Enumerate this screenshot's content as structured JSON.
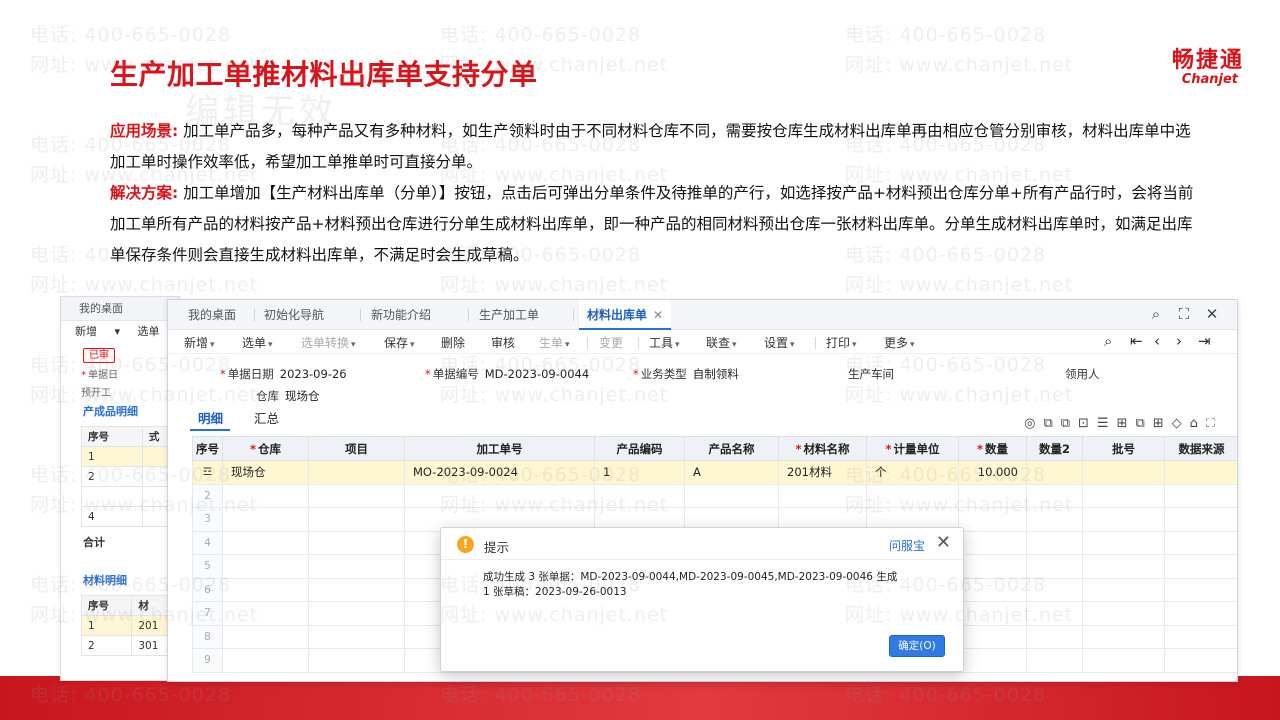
{
  "slide": {
    "title": "生产加工单推材料出库单支持分单",
    "ghost_text": "编辑无效",
    "logo_cn": "畅捷通",
    "logo_en": "Chanjet",
    "scene_label": "应用场景:",
    "scene_text": "加工单产品多，每种产品又有多种材料，如生产领料时由于不同材料仓库不同，需要按仓库生成材料出库单再由相应仓管分别审核，材料出库单中选加工单时操作效率低，希望加工单推单时可直接分单。",
    "solution_label": "解决方案:",
    "solution_text": "加工单增加【生产材料出库单（分单）】按钮，点击后可弹出分单条件及待推单的产行，如选择按产品+材料预出仓库分单+所有产品行时，会将当前加工单所有产品的材料按产品+材料预出仓库进行分单生成材料出库单，即一种产品的相同材料预出仓库一张材料出库单。分单生成材料出库单时，如满足出库单保存条件则会直接生成材料出库单，不满足时会生成草稿。"
  },
  "watermark": {
    "phone": "电话: 400-665-0028",
    "site": "网址: www.chanjet.net"
  },
  "back_window": {
    "tab": "我的桌面",
    "toolbar": [
      "新增",
      "选单"
    ],
    "badge": "已审",
    "field1": "单据日",
    "field2": "预开工",
    "section1": "产成品明细",
    "grid1_headers": [
      "序号",
      "式"
    ],
    "grid1_rows": [
      "1",
      "2",
      "",
      "4"
    ],
    "sum_label": "合计",
    "section2": "材料明细",
    "grid2_headers": [
      "序号",
      "材"
    ],
    "grid2_rows": [
      [
        "1",
        "201"
      ],
      [
        "2",
        "301"
      ]
    ]
  },
  "main_window": {
    "tabs": [
      "我的桌面",
      "初始化导航",
      "新功能介绍",
      "生产加工单",
      "材料出库单"
    ],
    "toolbar": {
      "new": "新增",
      "select": "选单",
      "convert": "选单转换",
      "save": "保存",
      "delete": "删除",
      "audit": "审核",
      "generate": "生单",
      "change": "变更",
      "tools": "工具",
      "link": "联查",
      "settings": "设置",
      "print": "打印",
      "more": "更多"
    },
    "form": {
      "date_label": "单据日期",
      "date_value": "2023-09-26",
      "code_label": "单据编号",
      "code_value": "MD-2023-09-0044",
      "biz_label": "业务类型",
      "biz_value": "自制领料",
      "workshop_label": "生产车间",
      "receiver_label": "领用人",
      "warehouse_label": "仓库",
      "warehouse_value": "现场仓"
    },
    "subtabs": [
      "明细",
      "汇总"
    ],
    "grid": {
      "headers": [
        "序号",
        "仓库",
        "项目",
        "加工单号",
        "产品编码",
        "产品名称",
        "材料名称",
        "计量单位",
        "数量",
        "数量2",
        "批号",
        "数据来源"
      ],
      "row1": {
        "warehouse": "现场仓",
        "project": "",
        "order": "MO-2023-09-0024",
        "product_code": "1",
        "product_name": "A",
        "material": "201材料",
        "unit": "个",
        "qty": "10.000"
      },
      "row_numbers": [
        "2",
        "3",
        "4",
        "5",
        "6",
        "7",
        "8",
        "9"
      ]
    }
  },
  "dialog": {
    "title": "提示",
    "help": "问服宝",
    "message_line1": "成功生成 3 张单据：MD-2023-09-0044,MD-2023-09-0045,MD-2023-09-0046 生成",
    "message_line2": "1 张草稿：2023-09-26-0013",
    "ok": "确定(O)"
  }
}
